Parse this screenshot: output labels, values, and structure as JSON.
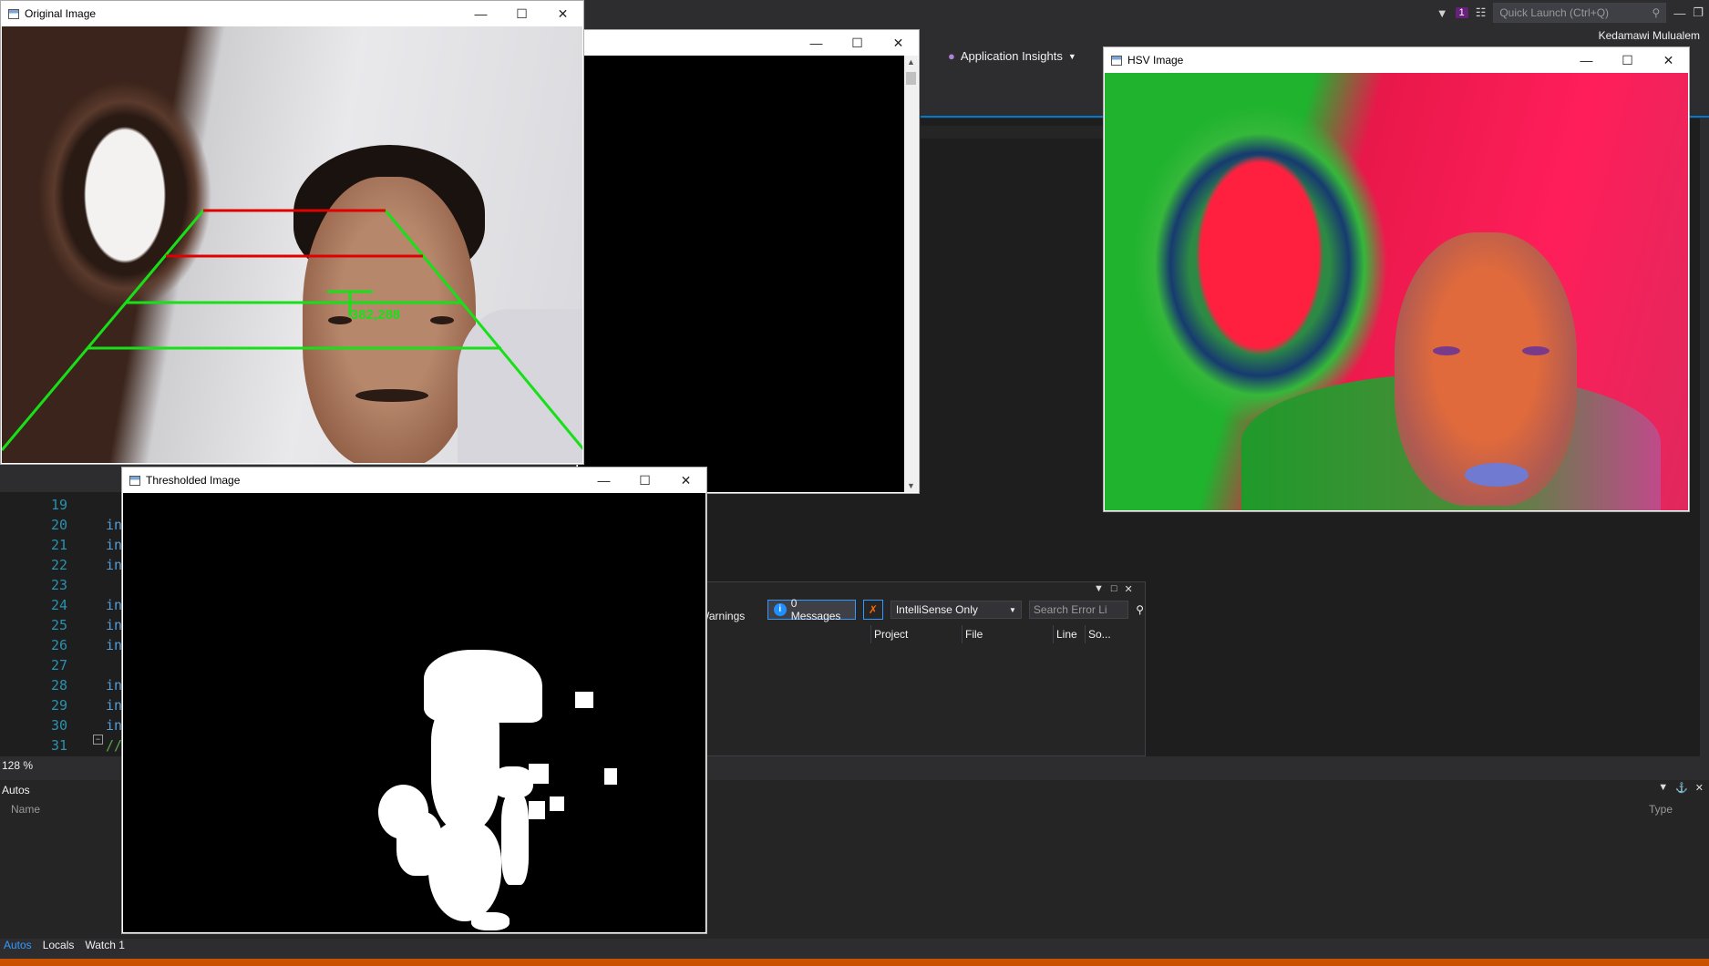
{
  "vs": {
    "quick_launch_placeholder": "Quick Launch (Ctrl+Q)",
    "notification_count": "1",
    "user_name": "Kedamawi Mulualem",
    "app_insights_label": "Application Insights",
    "zoom_level": "128 %",
    "code_lines": [
      {
        "num": "19",
        "text": ""
      },
      {
        "num": "20",
        "text": "in"
      },
      {
        "num": "21",
        "text": "in"
      },
      {
        "num": "22",
        "text": "in"
      },
      {
        "num": "23",
        "text": ""
      },
      {
        "num": "24",
        "text": "in"
      },
      {
        "num": "25",
        "text": "in"
      },
      {
        "num": "26",
        "text": "in"
      },
      {
        "num": "27",
        "text": ""
      },
      {
        "num": "28",
        "text": "in"
      },
      {
        "num": "29",
        "text": "in"
      },
      {
        "num": "30",
        "text": "in"
      },
      {
        "num": "31",
        "text": "//"
      }
    ],
    "error_list": {
      "warnings_label": "0 Warnings",
      "messages_label": "0 Messages",
      "scope_selected": "IntelliSense Only",
      "search_placeholder": "Search Error Li",
      "columns": [
        "Project",
        "File",
        "Line",
        "So..."
      ]
    },
    "autos": {
      "title": "Autos",
      "col_name": "Name",
      "col_type": "Type",
      "tabs": [
        "Autos",
        "Locals",
        "Watch 1"
      ]
    },
    "colors": {
      "accent": "#007acc",
      "status_bar": "#ca5100",
      "editor_bg": "#1e1e1e",
      "chrome_bg": "#2d2d30"
    }
  },
  "windows": {
    "original": {
      "title": "Original Image",
      "coord_label": "382,288",
      "overlay_colors": {
        "red": "#e00000",
        "green": "#18e018"
      }
    },
    "console": {
      "title": ""
    },
    "hsv": {
      "title": "HSV Image"
    },
    "thresholded": {
      "title": "Thresholded Image"
    }
  }
}
